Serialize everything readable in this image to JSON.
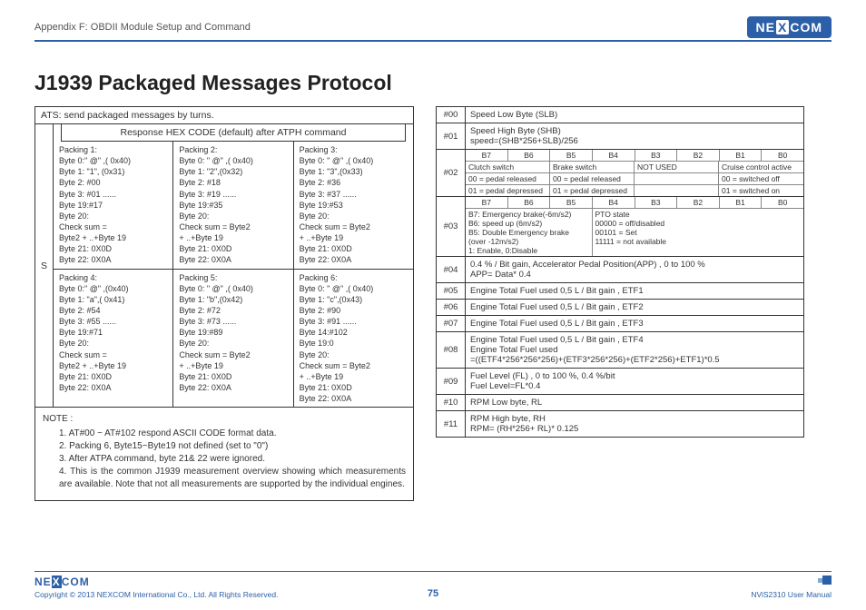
{
  "header": {
    "appendix": "Appendix F: OBDII Module Setup and Command",
    "logo_text": "NEXCOM"
  },
  "title": "J1939 Packaged Messages Protocol",
  "ats": {
    "head": "ATS: send packaged messages by turns.",
    "hex_head": "Response HEX CODE (default) after ATPH command",
    "s_label": "S",
    "rows": [
      [
        {
          "title": "Packing 1:",
          "lines": [
            "Byte 0:\" @\" ,( 0x40)",
            "Byte 1: \"1\", (0x31)",
            "Byte 2: #00",
            "Byte 3: #01 ......",
            "Byte 19:#17",
            "Byte 20:",
            "Check sum =",
            "Byte2 + ..+Byte 19",
            "Byte 21: 0X0D",
            "Byte 22: 0X0A"
          ]
        },
        {
          "title": "Packing 2:",
          "lines": [
            "Byte 0: \" @\" ,( 0x40)",
            "Byte 1: \"2\",(0x32)",
            "Byte 2: #18",
            "Byte 3: #19 ......",
            "Byte 19:#35",
            "Byte 20:",
            "Check sum = Byte2",
            "+ ..+Byte 19",
            "Byte 21: 0X0D",
            "Byte 22: 0X0A"
          ]
        },
        {
          "title": "Packing 3:",
          "lines": [
            "Byte 0: \" @\" ,( 0x40)",
            "Byte 1: \"3\",(0x33)",
            "Byte 2: #36",
            "Byte 3: #37 ......",
            "Byte 19:#53",
            "Byte 20:",
            "Check sum = Byte2",
            "+ ..+Byte 19",
            "Byte 21: 0X0D",
            "Byte 22: 0X0A"
          ]
        }
      ],
      [
        {
          "title": "Packing 4:",
          "lines": [
            "Byte 0:\" @\" ,(0x40)",
            "Byte 1: \"a\",( 0x41)",
            "Byte 2: #54",
            "Byte 3: #55 ......",
            "Byte 19:#71",
            "Byte 20:",
            "Check sum =",
            "Byte2 + ..+Byte 19",
            "Byte 21: 0X0D",
            "Byte 22: 0X0A"
          ]
        },
        {
          "title": "Packing 5:",
          "lines": [
            "Byte 0: \" @\" ,( 0x40)",
            "Byte 1: \"b\",(0x42)",
            "Byte 2: #72",
            "Byte 3: #73 ......",
            "Byte 19:#89",
            "Byte 20:",
            "Check sum = Byte2",
            "+ ..+Byte 19",
            "Byte 21: 0X0D",
            "Byte 22: 0X0A"
          ]
        },
        {
          "title": "Packing 6:",
          "lines": [
            "Byte 0: \" @\" ,( 0x40)",
            "Byte 1: \"c\",(0x43)",
            "Byte 2: #90",
            "Byte 3: #91 ......",
            "Byte 14:#102",
            "Byte 19:0",
            "Byte 20:",
            "Check sum = Byte2",
            "+ ..+Byte 19",
            "Byte 21: 0X0D",
            "Byte 22: 0X0A"
          ]
        }
      ]
    ]
  },
  "notes": {
    "heading": "NOTE :",
    "items": [
      "1. AT#00 ~ AT#102 respond ASCII CODE format data.",
      "2. Packing 6, Byte15~Byte19 not defined (set to \"0\")",
      "3. After ATPA command, byte 21& 22 were ignored.",
      "4. This is the common J1939 measurement overview showing which measurements are available. Note that not all measurements are supported by the individual engines."
    ]
  },
  "defs": {
    "r00": "Speed Low Byte (SLB)",
    "r01": "Speed High Byte (SHB)\nspeed=(SHB*256+SLB)/256",
    "bits": [
      "B7",
      "B6",
      "B5",
      "B4",
      "B3",
      "B2",
      "B1",
      "B0"
    ],
    "r02": {
      "row1": [
        "Clutch switch",
        "Brake switch",
        "NOT USED",
        "Cruise control active"
      ],
      "row2": [
        "00 = pedal released",
        "00 = pedal released",
        "",
        "00 = switched off"
      ],
      "row3": [
        "01 = pedal depressed",
        "01 = pedal depressed",
        "",
        "01 = switched on"
      ]
    },
    "r03": {
      "left": [
        "B7: Emergency brake(-6m/s2)",
        "B6: speed up (6m/s2)",
        "B5: Double Emergency brake",
        "(over -12m/s2)",
        "1: Enable, 0:Disable"
      ],
      "right_h": "PTO state",
      "right": [
        "00000 = off/disabled",
        "00101 = Set",
        "11111 = not available"
      ]
    },
    "r04": "0.4 % / Bit gain, Accelerator Pedal Position(APP) , 0 to 100 %\nAPP= Data* 0.4",
    "r05": "Engine Total Fuel used 0,5 L / Bit gain , ETF1",
    "r06": "Engine Total Fuel used 0,5 L / Bit gain , ETF2",
    "r07": "Engine Total Fuel used 0,5 L / Bit gain , ETF3",
    "r08": "Engine Total Fuel used 0,5 L / Bit gain , ETF4\nEngine Total Fuel used\n=((ETF4*256*256*256)+(ETF3*256*256)+(ETF2*256)+ETF1)*0.5",
    "r09": "Fuel Level (FL) , 0 to 100 %, 0.4 %/bit\nFuel Level=FL*0.4",
    "r10": "RPM Low byte, RL",
    "r11": "RPM High byte, RH\nRPM= (RH*256+ RL)* 0.125",
    "idx": [
      "#00",
      "#01",
      "#02",
      "#03",
      "#04",
      "#05",
      "#06",
      "#07",
      "#08",
      "#09",
      "#10",
      "#11"
    ]
  },
  "footer": {
    "copyright": "Copyright © 2013 NEXCOM International Co., Ltd. All Rights Reserved.",
    "page": "75",
    "manual": "NViS2310 User Manual",
    "logo": "NEXCOM"
  }
}
